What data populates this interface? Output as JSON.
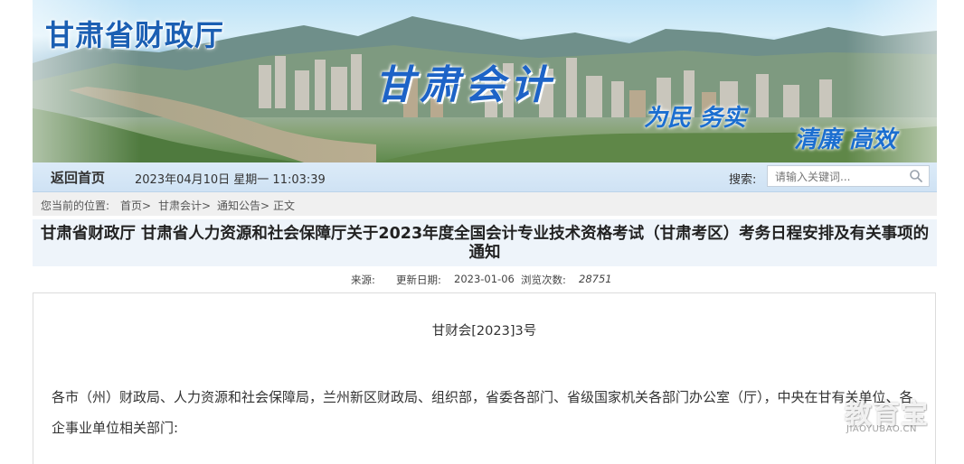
{
  "banner": {
    "site_title": "甘肃省财政厅",
    "slogan_main": "甘肃会计",
    "slogan_a": "为民 务实",
    "slogan_b": "清廉 高效"
  },
  "nav": {
    "home": "返回首页",
    "datetime": "2023年04月10日  星期一  11:03:39",
    "search_label": "搜索:",
    "search_placeholder": "请输入关键词..."
  },
  "breadcrumb": {
    "prefix": "您当前的位置:",
    "items": [
      "首页>",
      "甘肃会计>",
      "通知公告>",
      "正文"
    ]
  },
  "article": {
    "title": "甘肃省财政厅 甘肃省人力资源和社会保障厅关于2023年度全国会计专业技术资格考试（甘肃考区）考务日程安排及有关事项的通知",
    "source_label": "来源:",
    "date_label": "更新日期:",
    "date": "2023-01-06",
    "views_label": "浏览次数:",
    "views": "28751",
    "doc_number": "甘财会[2023]3号",
    "paragraph": "各市（州）财政局、人力资源和社会保障局，兰州新区财政局、组织部，省委各部门、省级国家机关各部门办公室（厅），中央在甘有关单位、各企事业单位相关部门:"
  },
  "watermark": {
    "text": "教育宝",
    "url": "JIAOYUBAO.CN"
  }
}
